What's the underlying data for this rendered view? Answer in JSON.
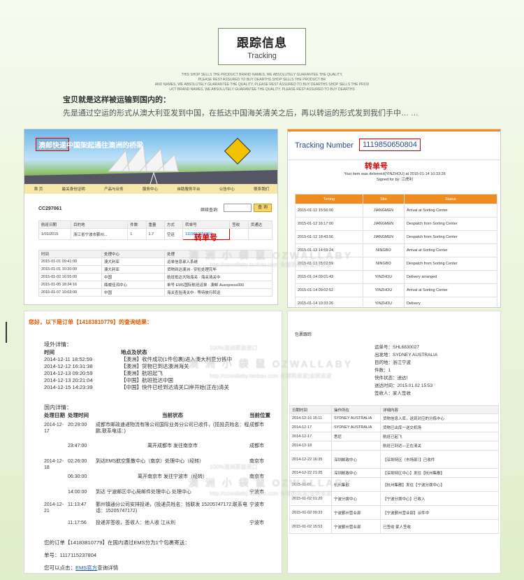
{
  "header": {
    "title_cn": "跟踪信息",
    "title_en": "Tracking",
    "fine": [
      "THIS SHOP SELLS THE PRODUCT BRAND NAMES, WE ABSOLUTELY GUARANTEE THE QUALITY,",
      "PLEASE REST ASSURED TO BUY DEARTHS SHOP SELLS THE PRODUCT BR",
      "AND NAMES, WE ABSOLUTELY GUARANTEE THE QUALITY, PLEASE REST ASSURED TO BUY DEARTHS SHOP SELLS THE PROD",
      "UCT BRAND NAMES, WE ABSOLUTELY GUARANTEE THE QUALITY, PLEASE REST ASSURED TO BUY DEARTHS"
    ]
  },
  "intro": {
    "line1": "宝贝就是这样被运输到国内的：",
    "line2": "先是通过空运的形式从澳大利亚发到中国，在抵达中国海关清关之后，再以转运的形式发到我们手中… …"
  },
  "panel1": {
    "banner_title": "澳邮快递",
    "banner_sub": "中国架起通往澳洲的桥梁",
    "nav": [
      "首 页",
      "最关身份证明",
      "产品与业务",
      "服务中心",
      "自助服务平台",
      "公告中心",
      "联系我们"
    ],
    "order_no": "CC297061",
    "query_label": "继续查询:",
    "query_btn": "查 询",
    "headers": [
      "航班日期",
      "目的地",
      "件数",
      "重量",
      "方式",
      "转单号",
      "签收",
      "货通达"
    ],
    "row": [
      "1/01/2015",
      "浙江省宁波市鄞州...",
      "1",
      "1.7",
      "空运",
      "1119850650804",
      "",
      ""
    ],
    "annot": "转单号",
    "log_headers": [
      "时间",
      "处理中心",
      "处理"
    ],
    "log": [
      [
        "2015-01-01 09:41:00",
        "澳大利亚",
        "运单信息录入系统"
      ],
      [
        "2015-01-01 10:20:00",
        "澳大利亚",
        "货物到达澳洲 · 安检处理完毕"
      ],
      [
        "2015-01-02 16:55:00",
        "中国",
        "航班抵达大陆海关 · 海关清关中"
      ],
      [
        "2015-01-05 18:24:16",
        "鼎威佳鸿中心",
        "单号 EMS国际航班运单 · 澳邮 Auexpress000"
      ],
      [
        "2015-01-07 10:03:00",
        "中国",
        "海关查验清关中 · 等待放行转运"
      ]
    ]
  },
  "panel2": {
    "label": "Tracking Number",
    "number": "1119850650804",
    "annot": "转单号",
    "msg1": "Your item was delivered(YINZHOU) at 2015-01-14 10:33:26",
    "msg2": "Signed for by: 江虎利",
    "headers": [
      "Timing",
      "Site",
      "Status"
    ],
    "rows": [
      [
        "2015-01-12 15:56:00",
        "JIANGMEN",
        "Arrival at Sorting Center"
      ],
      [
        "2015-01-12 16:17:00",
        "JIANGMEN",
        "Despatch from Sorting Center"
      ],
      [
        "2015-01-12 18:43:56",
        "JIANGMEN",
        "Despatch from Sorting Center"
      ],
      [
        "2015-01-13 14:59:24",
        "NINGBO",
        "Arrival at Sorting Center"
      ],
      [
        "2015-01-13 15:02:59",
        "NINGBO",
        "Despatch from Sorting Center"
      ],
      [
        "2015-01-14 09:01:43",
        "YINZHOU",
        "Delivery arranged"
      ],
      [
        "2015-01-14 09:02:52",
        "YINZHOU",
        "Arrival at Sorting Center"
      ],
      [
        "2015-01-14 10:33:26",
        "YINZHOU",
        "Delivery"
      ]
    ]
  },
  "watermark": {
    "big": "澳 洲 小 袋 鼠 OZWALLABY",
    "small": "http://ozwallaby.taobao.com  全球购卖家|金牌卖家",
    "mid": "100%澳洲原装进口"
  },
  "panel3": {
    "title": "您好，以下是订单【14183810779】的查询结果：",
    "intl_label": "境外详情：",
    "intl_headers": [
      "时间",
      "地点及状态"
    ],
    "intl": [
      [
        "2014-12-11 18:52:59",
        "【澳洲】收件成功(1件包裹)进入澳大利亚分拣中"
      ],
      [
        "2014-12-12 16:31:38",
        "【澳洲】货物已到达澳洲海关"
      ],
      [
        "2014-12-13 09:20:59",
        "【澳洲】航班起飞"
      ],
      [
        "2014-12-13 20:21:04",
        "【中国】航班抵达中国"
      ],
      [
        "2014-12-15 14:23:39",
        "【中国】快件已经到达清关口岸开始(正在)清关"
      ]
    ],
    "dom_label": "国内详情：",
    "dom_headers": [
      "处理日期",
      "处理时间",
      "当前状态",
      "当前位置"
    ],
    "dom": [
      [
        "2014-12-17",
        "20:29:00",
        "成都市邮政速递物流有限公司国际业务分公司已收件，(揽投员姓名：程鹏,联系电话：)",
        "成都市"
      ],
      [
        "",
        "23:47:00",
        "离开成都市 发往南京市",
        "成都市"
      ],
      [
        "2014-12-18",
        "02:26:00",
        "到达EMS航空集散中心（南京）处理中心（经转）",
        "南京市"
      ],
      [
        "",
        "06:30:00",
        "离开南京市 发往宁波市（经转）",
        "南京市"
      ],
      [
        "",
        "14:00:00",
        "到达 宁波邮区中心局邮件处理中心 处理中心",
        "宁波市"
      ],
      [
        "2014-12-21",
        "11:13:47",
        "鄞州镇通分公司安排投递，(投递员姓名：钱联发 15205747172,联系电话：15205747172)",
        "宁波市"
      ],
      [
        "",
        "11:17:56",
        "投递并签收，签收人：他人收 江从利",
        "宁波市"
      ]
    ],
    "footer1": "您的订单【14183810779】在国内通过EMS分为1个包裹寄送：",
    "footer2": "单号：1117115237804",
    "footer3_pre": "您可以点击：",
    "footer3_link": "EMS官方",
    "footer3_post": "查询详情"
  },
  "panel4": {
    "crumb": "包裹跟踪",
    "info": [
      "运单号：SHL6830027",
      "出发地：SYDNEY AUSTRALIA",
      "目的地：浙江宁波",
      "件数：1",
      "快件状态：送达!",
      "送达时间：2015.01.02 15:53",
      "签收人：家人签收"
    ],
    "headers": [
      "日期时间",
      "操作所在",
      "详细内容"
    ],
    "rows": [
      [
        "2014-12-16 15:11",
        "SYDNEY AUSTRALIA",
        "货物信息入库，送到对应的分拣中心"
      ],
      [
        "2014-12-17",
        "SYDNEY AUSTRALIA",
        "货物已出库一送交机场"
      ],
      [
        "2014-12-17",
        "悉尼",
        "航班已起飞"
      ],
      [
        "2014-12-18",
        "",
        "航班已到达—正在清关"
      ],
      [
        "2014-12-22 16:35",
        "深圳邮政中心",
        "【深圳特区（市场部）】已收件"
      ],
      [
        "2014-12-22 21:25",
        "深圳邮政中心",
        "【深圳特区中心】发往【杭州集散】"
      ],
      [
        "2015-01-01",
        "杭州集散",
        "【杭州集散】发往【宁波分拨中心】"
      ],
      [
        "2015-01-02 01:20",
        "宁波分拨中心",
        "【宁波分拨中心】已收入"
      ],
      [
        "2015-01-02 09:33",
        "宁波鄞州营业部",
        "【宁波鄞州营业部】派件中"
      ],
      [
        "2015-01-02 15:53",
        "宁波鄞州营业部",
        "已签收 家人签收"
      ]
    ]
  }
}
